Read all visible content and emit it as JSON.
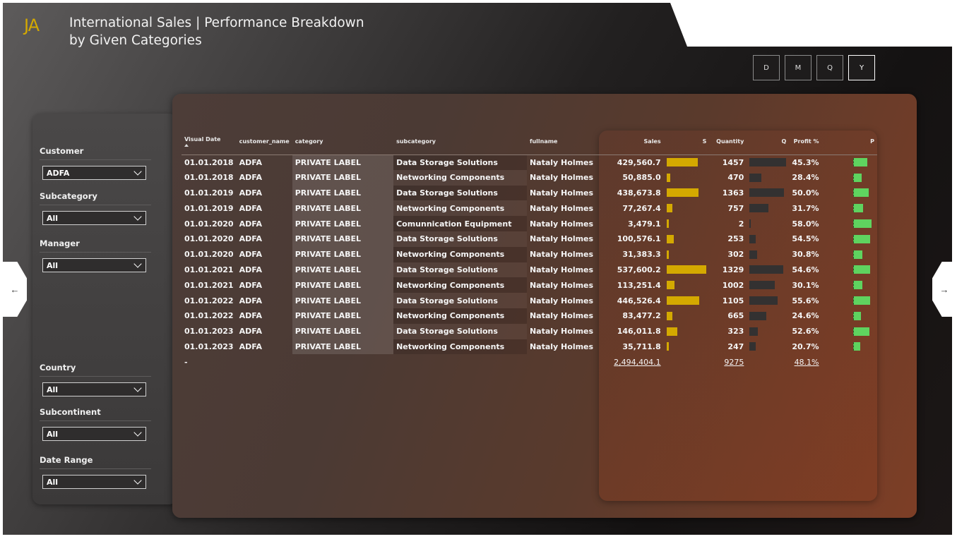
{
  "logo": "JA",
  "title": "International Sales | Performance Breakdown by Given Categories",
  "period_buttons": [
    "D",
    "M",
    "Q",
    "Y"
  ],
  "slicers": {
    "customer": {
      "label": "Customer",
      "value": "ADFA"
    },
    "subcategory": {
      "label": "Subcategory",
      "value": "All"
    },
    "manager": {
      "label": "Manager",
      "value": "All"
    },
    "country": {
      "label": "Country",
      "value": "All"
    },
    "subcontinent": {
      "label": "Subcontinent",
      "value": "All"
    },
    "date_range": {
      "label": "Date Range",
      "value": "All"
    }
  },
  "table": {
    "headers": {
      "date": "Visual Date",
      "customer": "customer_name",
      "category": "category",
      "subcategory": "subcategory",
      "fullname": "fullname",
      "sales": "Sales",
      "s": "S",
      "quantity": "Quantity",
      "q": "Q",
      "profit": "Profit %",
      "p": "P"
    },
    "rows": [
      {
        "date": "01.01.2018",
        "customer": "ADFA",
        "category": "PRIVATE LABEL",
        "subcategory": "Data Storage Solutions",
        "fullname": "Nataly Holmes",
        "sales": "429,560.7",
        "quantity": "1457",
        "profit": "45.3%",
        "s": 429560.7,
        "q": 1457,
        "p": 45.3
      },
      {
        "date": "01.01.2018",
        "customer": "ADFA",
        "category": "PRIVATE LABEL",
        "subcategory": "Networking Components",
        "fullname": "Nataly Holmes",
        "sales": "50,885.0",
        "quantity": "470",
        "profit": "28.4%",
        "s": 50885.0,
        "q": 470,
        "p": 28.4
      },
      {
        "date": "01.01.2019",
        "customer": "ADFA",
        "category": "PRIVATE LABEL",
        "subcategory": "Data Storage Solutions",
        "fullname": "Nataly Holmes",
        "sales": "438,673.8",
        "quantity": "1363",
        "profit": "50.0%",
        "s": 438673.8,
        "q": 1363,
        "p": 50.0
      },
      {
        "date": "01.01.2019",
        "customer": "ADFA",
        "category": "PRIVATE LABEL",
        "subcategory": "Networking Components",
        "fullname": "Nataly Holmes",
        "sales": "77,267.4",
        "quantity": "757",
        "profit": "31.7%",
        "s": 77267.4,
        "q": 757,
        "p": 31.7
      },
      {
        "date": "01.01.2020",
        "customer": "ADFA",
        "category": "PRIVATE LABEL",
        "subcategory": "Comunnication Equipment",
        "fullname": "Nataly Holmes",
        "sales": "3,479.1",
        "quantity": "2",
        "profit": "58.0%",
        "s": 3479.1,
        "q": 2,
        "p": 58.0
      },
      {
        "date": "01.01.2020",
        "customer": "ADFA",
        "category": "PRIVATE LABEL",
        "subcategory": "Data Storage Solutions",
        "fullname": "Nataly Holmes",
        "sales": "100,576.1",
        "quantity": "253",
        "profit": "54.5%",
        "s": 100576.1,
        "q": 253,
        "p": 54.5
      },
      {
        "date": "01.01.2020",
        "customer": "ADFA",
        "category": "PRIVATE LABEL",
        "subcategory": "Networking Components",
        "fullname": "Nataly Holmes",
        "sales": "31,383.3",
        "quantity": "302",
        "profit": "30.8%",
        "s": 31383.3,
        "q": 302,
        "p": 30.8
      },
      {
        "date": "01.01.2021",
        "customer": "ADFA",
        "category": "PRIVATE LABEL",
        "subcategory": "Data Storage Solutions",
        "fullname": "Nataly Holmes",
        "sales": "537,600.2",
        "quantity": "1329",
        "profit": "54.6%",
        "s": 537600.2,
        "q": 1329,
        "p": 54.6
      },
      {
        "date": "01.01.2021",
        "customer": "ADFA",
        "category": "PRIVATE LABEL",
        "subcategory": "Networking Components",
        "fullname": "Nataly Holmes",
        "sales": "113,251.4",
        "quantity": "1002",
        "profit": "30.1%",
        "s": 113251.4,
        "q": 1002,
        "p": 30.1
      },
      {
        "date": "01.01.2022",
        "customer": "ADFA",
        "category": "PRIVATE LABEL",
        "subcategory": "Data Storage Solutions",
        "fullname": "Nataly Holmes",
        "sales": "446,526.4",
        "quantity": "1105",
        "profit": "55.6%",
        "s": 446526.4,
        "q": 1105,
        "p": 55.6
      },
      {
        "date": "01.01.2022",
        "customer": "ADFA",
        "category": "PRIVATE LABEL",
        "subcategory": "Networking Components",
        "fullname": "Nataly Holmes",
        "sales": "83,477.2",
        "quantity": "665",
        "profit": "24.6%",
        "s": 83477.2,
        "q": 665,
        "p": 24.6
      },
      {
        "date": "01.01.2023",
        "customer": "ADFA",
        "category": "PRIVATE LABEL",
        "subcategory": "Data Storage Solutions",
        "fullname": "Nataly Holmes",
        "sales": "146,011.8",
        "quantity": "323",
        "profit": "52.6%",
        "s": 146011.8,
        "q": 323,
        "p": 52.6
      },
      {
        "date": "01.01.2023",
        "customer": "ADFA",
        "category": "PRIVATE LABEL",
        "subcategory": "Networking Components",
        "fullname": "Nataly Holmes",
        "sales": "35,711.8",
        "quantity": "247",
        "profit": "20.7%",
        "s": 35711.8,
        "q": 247,
        "p": 20.7
      }
    ],
    "totals": {
      "sales": "2,494,404.1",
      "quantity": "9275",
      "profit": "48.1%"
    },
    "bar_colors": {
      "sales": "#d4a900",
      "quantity": "#333131",
      "profit": "#5fd35f"
    }
  },
  "nav": {
    "left_icon": "arrow-left-icon",
    "right_icon": "arrow-right-icon"
  }
}
